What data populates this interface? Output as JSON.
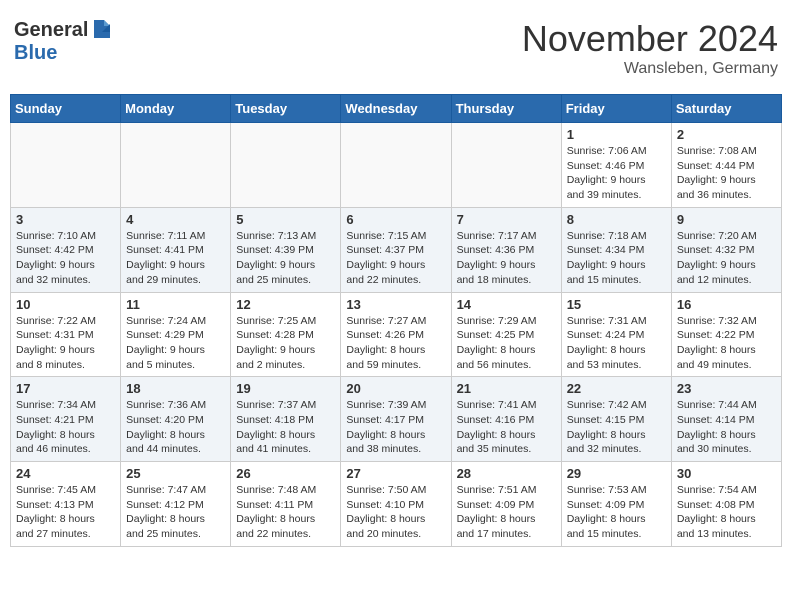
{
  "logo": {
    "general": "General",
    "blue": "Blue"
  },
  "header": {
    "month": "November 2024",
    "location": "Wansleben, Germany"
  },
  "weekdays": [
    "Sunday",
    "Monday",
    "Tuesday",
    "Wednesday",
    "Thursday",
    "Friday",
    "Saturday"
  ],
  "weeks": [
    [
      {
        "day": "",
        "info": ""
      },
      {
        "day": "",
        "info": ""
      },
      {
        "day": "",
        "info": ""
      },
      {
        "day": "",
        "info": ""
      },
      {
        "day": "",
        "info": ""
      },
      {
        "day": "1",
        "info": "Sunrise: 7:06 AM\nSunset: 4:46 PM\nDaylight: 9 hours and 39 minutes."
      },
      {
        "day": "2",
        "info": "Sunrise: 7:08 AM\nSunset: 4:44 PM\nDaylight: 9 hours and 36 minutes."
      }
    ],
    [
      {
        "day": "3",
        "info": "Sunrise: 7:10 AM\nSunset: 4:42 PM\nDaylight: 9 hours and 32 minutes."
      },
      {
        "day": "4",
        "info": "Sunrise: 7:11 AM\nSunset: 4:41 PM\nDaylight: 9 hours and 29 minutes."
      },
      {
        "day": "5",
        "info": "Sunrise: 7:13 AM\nSunset: 4:39 PM\nDaylight: 9 hours and 25 minutes."
      },
      {
        "day": "6",
        "info": "Sunrise: 7:15 AM\nSunset: 4:37 PM\nDaylight: 9 hours and 22 minutes."
      },
      {
        "day": "7",
        "info": "Sunrise: 7:17 AM\nSunset: 4:36 PM\nDaylight: 9 hours and 18 minutes."
      },
      {
        "day": "8",
        "info": "Sunrise: 7:18 AM\nSunset: 4:34 PM\nDaylight: 9 hours and 15 minutes."
      },
      {
        "day": "9",
        "info": "Sunrise: 7:20 AM\nSunset: 4:32 PM\nDaylight: 9 hours and 12 minutes."
      }
    ],
    [
      {
        "day": "10",
        "info": "Sunrise: 7:22 AM\nSunset: 4:31 PM\nDaylight: 9 hours and 8 minutes."
      },
      {
        "day": "11",
        "info": "Sunrise: 7:24 AM\nSunset: 4:29 PM\nDaylight: 9 hours and 5 minutes."
      },
      {
        "day": "12",
        "info": "Sunrise: 7:25 AM\nSunset: 4:28 PM\nDaylight: 9 hours and 2 minutes."
      },
      {
        "day": "13",
        "info": "Sunrise: 7:27 AM\nSunset: 4:26 PM\nDaylight: 8 hours and 59 minutes."
      },
      {
        "day": "14",
        "info": "Sunrise: 7:29 AM\nSunset: 4:25 PM\nDaylight: 8 hours and 56 minutes."
      },
      {
        "day": "15",
        "info": "Sunrise: 7:31 AM\nSunset: 4:24 PM\nDaylight: 8 hours and 53 minutes."
      },
      {
        "day": "16",
        "info": "Sunrise: 7:32 AM\nSunset: 4:22 PM\nDaylight: 8 hours and 49 minutes."
      }
    ],
    [
      {
        "day": "17",
        "info": "Sunrise: 7:34 AM\nSunset: 4:21 PM\nDaylight: 8 hours and 46 minutes."
      },
      {
        "day": "18",
        "info": "Sunrise: 7:36 AM\nSunset: 4:20 PM\nDaylight: 8 hours and 44 minutes."
      },
      {
        "day": "19",
        "info": "Sunrise: 7:37 AM\nSunset: 4:18 PM\nDaylight: 8 hours and 41 minutes."
      },
      {
        "day": "20",
        "info": "Sunrise: 7:39 AM\nSunset: 4:17 PM\nDaylight: 8 hours and 38 minutes."
      },
      {
        "day": "21",
        "info": "Sunrise: 7:41 AM\nSunset: 4:16 PM\nDaylight: 8 hours and 35 minutes."
      },
      {
        "day": "22",
        "info": "Sunrise: 7:42 AM\nSunset: 4:15 PM\nDaylight: 8 hours and 32 minutes."
      },
      {
        "day": "23",
        "info": "Sunrise: 7:44 AM\nSunset: 4:14 PM\nDaylight: 8 hours and 30 minutes."
      }
    ],
    [
      {
        "day": "24",
        "info": "Sunrise: 7:45 AM\nSunset: 4:13 PM\nDaylight: 8 hours and 27 minutes."
      },
      {
        "day": "25",
        "info": "Sunrise: 7:47 AM\nSunset: 4:12 PM\nDaylight: 8 hours and 25 minutes."
      },
      {
        "day": "26",
        "info": "Sunrise: 7:48 AM\nSunset: 4:11 PM\nDaylight: 8 hours and 22 minutes."
      },
      {
        "day": "27",
        "info": "Sunrise: 7:50 AM\nSunset: 4:10 PM\nDaylight: 8 hours and 20 minutes."
      },
      {
        "day": "28",
        "info": "Sunrise: 7:51 AM\nSunset: 4:09 PM\nDaylight: 8 hours and 17 minutes."
      },
      {
        "day": "29",
        "info": "Sunrise: 7:53 AM\nSunset: 4:09 PM\nDaylight: 8 hours and 15 minutes."
      },
      {
        "day": "30",
        "info": "Sunrise: 7:54 AM\nSunset: 4:08 PM\nDaylight: 8 hours and 13 minutes."
      }
    ]
  ]
}
